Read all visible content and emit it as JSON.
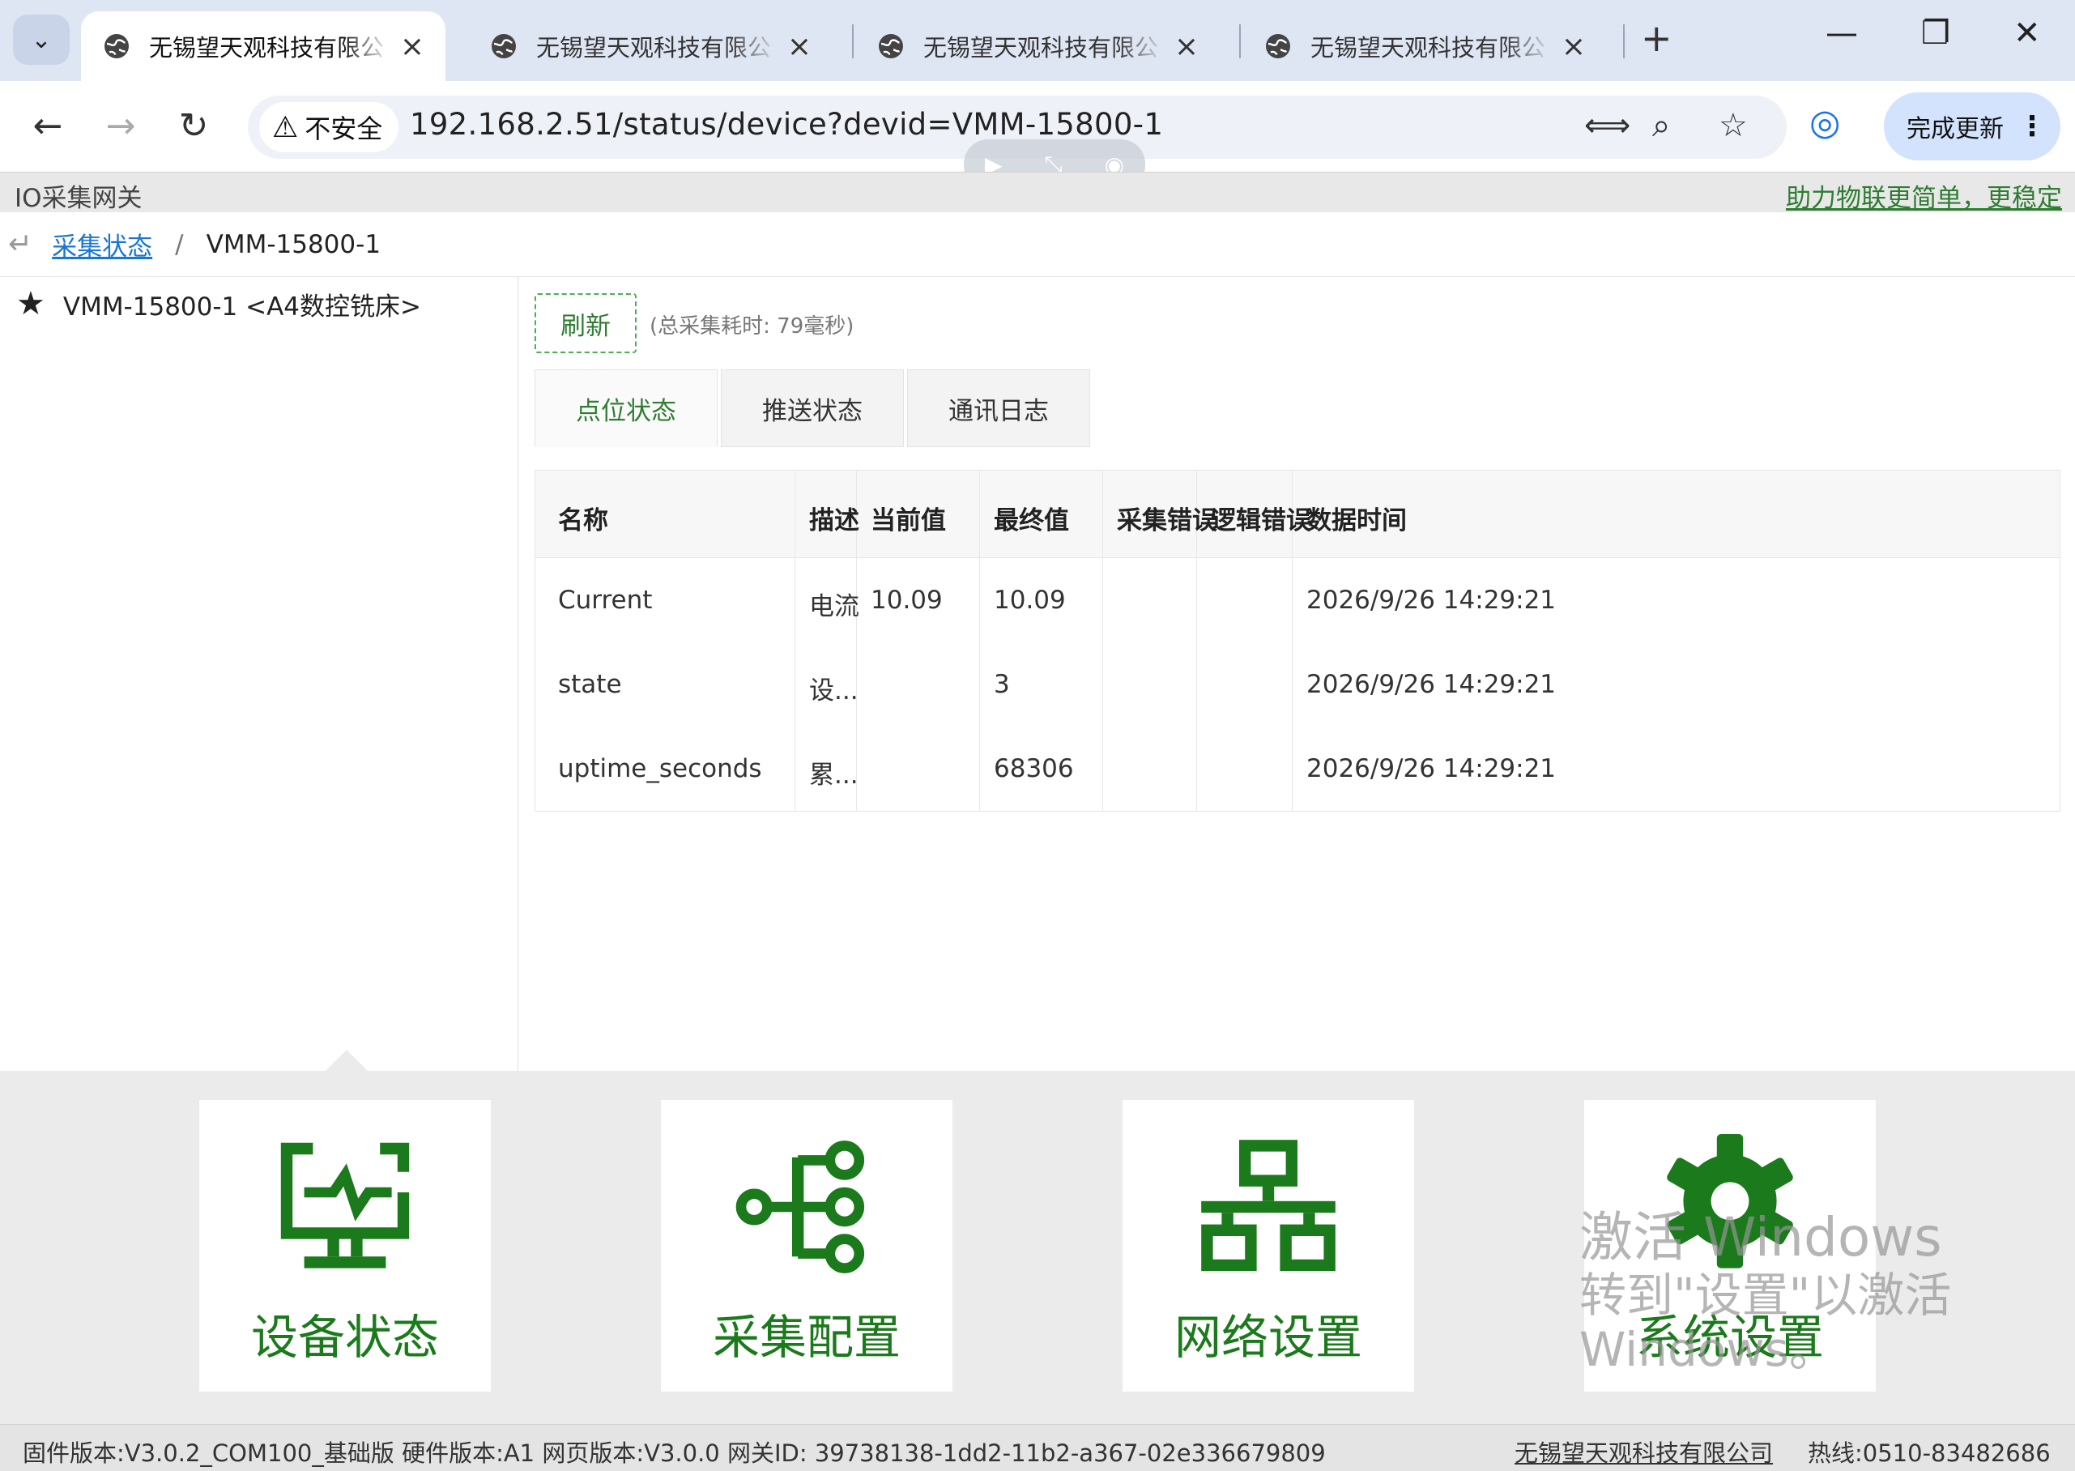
{
  "browser": {
    "tabs": [
      {
        "title": "无锡望天观科技有限公",
        "active": true
      },
      {
        "title": "无锡望天观科技有限公",
        "active": false
      },
      {
        "title": "无锡望天观科技有限公",
        "active": false
      },
      {
        "title": "无锡望天观科技有限公",
        "active": false
      }
    ],
    "security_label": "不安全",
    "url": "192.168.2.51/status/device?devid=VMM-15800-1",
    "update_label": "完成更新"
  },
  "header": {
    "brand": "IO采集网关",
    "slogan": "助力物联更简单，更稳定"
  },
  "breadcrumb": {
    "link": "采集状态",
    "separator": "/",
    "current": "VMM-15800-1"
  },
  "device_list": [
    {
      "label": "VMM-15800-1 <A4数控铣床>"
    }
  ],
  "refresh": {
    "label": "刷新",
    "elapsed": "(总采集耗时: 79毫秒)"
  },
  "tabs": [
    {
      "label": "点位状态",
      "active": true
    },
    {
      "label": "推送状态",
      "active": false
    },
    {
      "label": "通讯日志",
      "active": false
    }
  ],
  "table": {
    "headers": [
      "名称",
      "描述",
      "当前值",
      "最终值",
      "采集错误",
      "逻辑错误",
      "数据时间"
    ],
    "rows": [
      [
        "Current",
        "电流",
        "10.09",
        "10.09",
        "",
        "",
        "2026/9/26 14:29:21"
      ],
      [
        "state",
        "设...",
        "",
        "3",
        "",
        "",
        "2026/9/26 14:29:21"
      ],
      [
        "uptime_seconds",
        "累...",
        "",
        "68306",
        "",
        "",
        "2026/9/26 14:29:21"
      ]
    ]
  },
  "menu_tiles": [
    {
      "label": "设备状态",
      "icon": "monitor-pulse-icon"
    },
    {
      "label": "采集配置",
      "icon": "node-tree-icon"
    },
    {
      "label": "网络设置",
      "icon": "network-icon"
    },
    {
      "label": "系统设置",
      "icon": "gear-icon"
    }
  ],
  "watermark": {
    "line1": "激活 Windows",
    "line2": "转到\"设置\"以激活",
    "line3": "Windows。"
  },
  "footer": {
    "info": "固件版本:V3.0.2_COM100_基础版  硬件版本:A1  网页版本:V3.0.0  网关ID: 39738138-1dd2-11b2-a367-02e336679809",
    "company": "无锡望天观科技有限公司",
    "hotline": "热线:0510-83482686"
  },
  "colors": {
    "accent_green": "#1b7a1b",
    "link_blue": "#1976d2"
  }
}
